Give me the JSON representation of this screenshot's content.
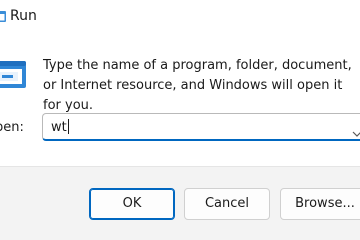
{
  "window": {
    "title": "Run"
  },
  "dialog": {
    "description": "Type the name of a program, folder, document, or Internet resource, and Windows will open it for you.",
    "open_label": "Open:",
    "open_label_visible": "pen:",
    "input_value": "wt"
  },
  "buttons": {
    "ok": "OK",
    "cancel": "Cancel",
    "browse": "Browse..."
  },
  "icons": {
    "title_icon": "run-icon",
    "app_icon": "run-dialog-icon",
    "dropdown": "chevron-down-icon"
  },
  "colors": {
    "accent": "#0067c0",
    "footer_bg": "#f3f3f3",
    "window_bg": "#ffffff"
  }
}
